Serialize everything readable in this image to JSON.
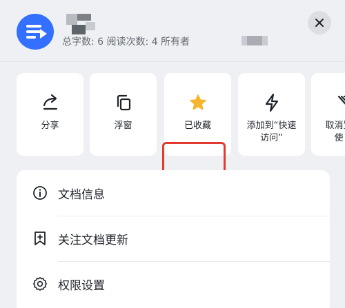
{
  "header": {
    "meta_text": "总字数: 6  阅读次数: 4  所有者",
    "close_icon": "close-icon"
  },
  "actions": [
    {
      "label": "分享",
      "icon": "share-icon"
    },
    {
      "label": "浮窗",
      "icon": "floating-window-icon"
    },
    {
      "label": "已收藏",
      "icon": "star-icon",
      "highlighted": true
    },
    {
      "label_line1": "添加到“快速",
      "label_line2": "访问”",
      "icon": "lightning-icon"
    },
    {
      "label_line1": "取消置",
      "label_line2": "使",
      "icon": "unpin-icon"
    }
  ],
  "menu": [
    {
      "label": "文档信息",
      "icon": "info-icon"
    },
    {
      "label": "关注文档更新",
      "icon": "bookmark-plus-icon"
    },
    {
      "label": "权限设置",
      "icon": "gear-icon"
    }
  ],
  "colors": {
    "accent": "#3370ff",
    "star": "#f5b52d",
    "highlight_box": "#e23a2e",
    "background": "#eef0f3"
  }
}
